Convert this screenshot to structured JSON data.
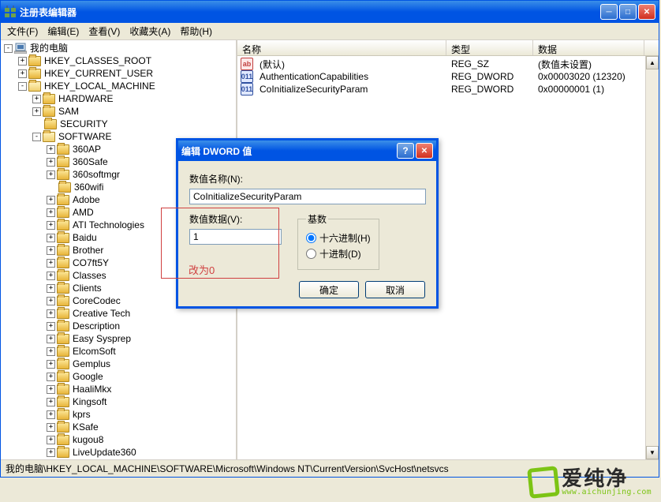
{
  "window": {
    "title": "注册表编辑器"
  },
  "menu": [
    "文件(F)",
    "编辑(E)",
    "查看(V)",
    "收藏夹(A)",
    "帮助(H)"
  ],
  "tree": {
    "root": "我的电脑",
    "keys": [
      "HKEY_CLASSES_ROOT",
      "HKEY_CURRENT_USER",
      "HKEY_LOCAL_MACHINE"
    ],
    "hklm_children": [
      "HARDWARE",
      "SAM",
      "SECURITY",
      "SOFTWARE"
    ],
    "software_children": [
      "360AP",
      "360Safe",
      "360softmgr",
      "360wifi",
      "Adobe",
      "AMD",
      "ATI Technologies",
      "Baidu",
      "Brother",
      "CO7ft5Y",
      "Classes",
      "Clients",
      "CoreCodec",
      "Creative Tech",
      "Description",
      "Easy Sysprep",
      "ElcomSoft",
      "Gemplus",
      "Google",
      "HaaliMkx",
      "Kingsoft",
      "kprs",
      "KSafe",
      "kugou8",
      "LiveUpdate360"
    ]
  },
  "list": {
    "headers": {
      "name": "名称",
      "type": "类型",
      "data": "数据"
    },
    "rows": [
      {
        "icon": "sz",
        "iconText": "ab",
        "name": "(默认)",
        "type": "REG_SZ",
        "data": "(数值未设置)"
      },
      {
        "icon": "dw",
        "iconText": "011",
        "name": "AuthenticationCapabilities",
        "type": "REG_DWORD",
        "data": "0x00003020 (12320)"
      },
      {
        "icon": "dw",
        "iconText": "011",
        "name": "CoInitializeSecurityParam",
        "type": "REG_DWORD",
        "data": "0x00000001 (1)"
      }
    ]
  },
  "dialog": {
    "title": "编辑 DWORD 值",
    "name_label": "数值名称(N):",
    "name_value": "CoInitializeSecurityParam",
    "data_label": "数值数据(V):",
    "data_value": "1",
    "base_label": "基数",
    "hex_label": "十六进制(H)",
    "dec_label": "十进制(D)",
    "ok": "确定",
    "cancel": "取消"
  },
  "annotation": "改为0",
  "status": "我的电脑\\HKEY_LOCAL_MACHINE\\SOFTWARE\\Microsoft\\Windows NT\\CurrentVersion\\SvcHost\\netsvcs",
  "watermark": {
    "cn": "爱纯净",
    "url": "www.aichunjing.com"
  }
}
